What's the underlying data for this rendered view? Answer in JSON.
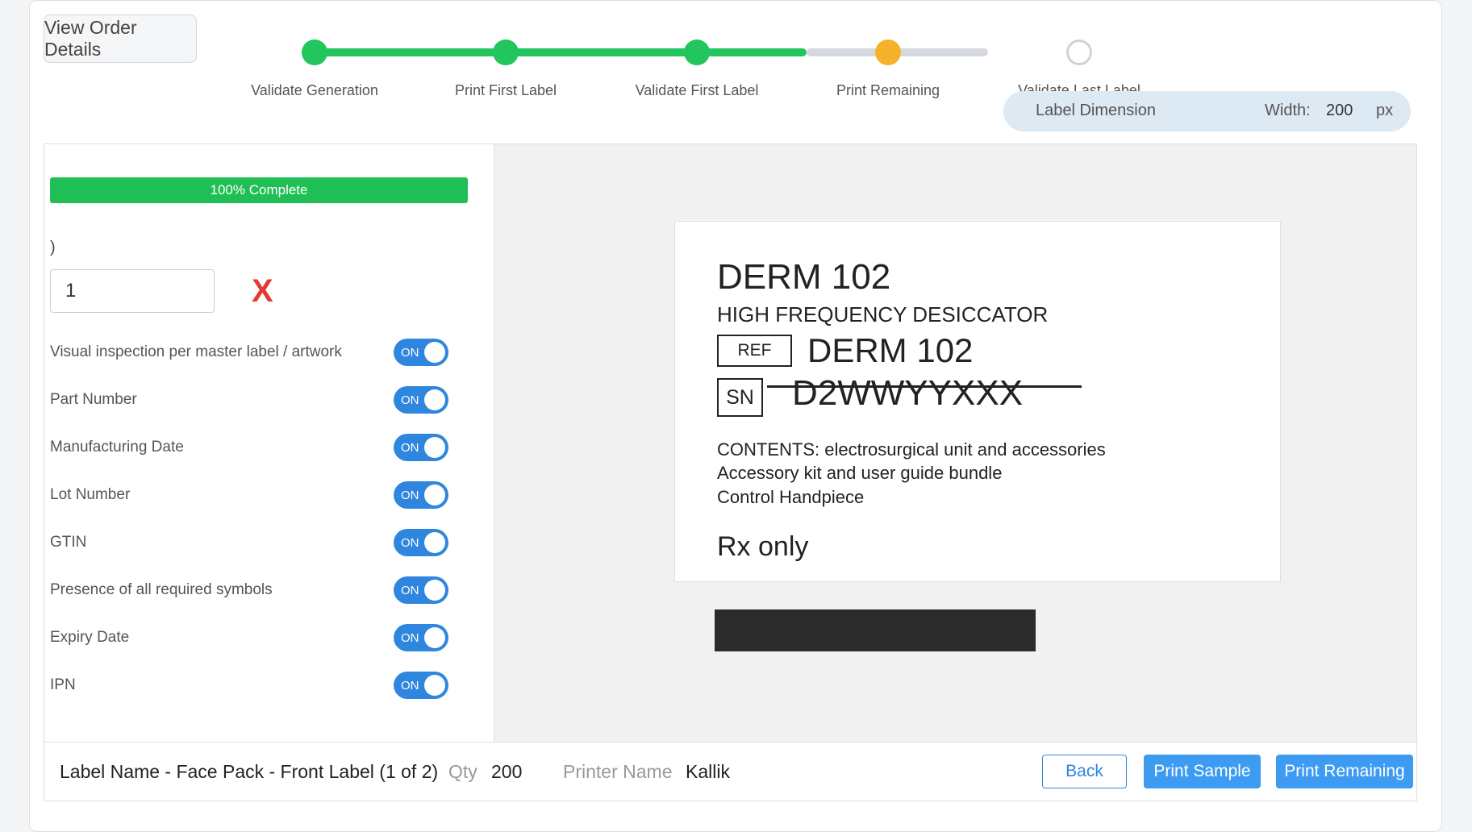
{
  "header": {
    "view_order_button": "View Order Details"
  },
  "stepper": {
    "steps": [
      {
        "label": "Validate Generation",
        "state": "done"
      },
      {
        "label": "Print First Label",
        "state": "done"
      },
      {
        "label": "Validate First Label",
        "state": "done"
      },
      {
        "label": "Print Remaining",
        "state": "current"
      },
      {
        "label": "Validate Last Label",
        "state": "pending"
      }
    ],
    "colors": {
      "done": "#22c55e",
      "current": "#f5b12a",
      "pending": "#d5d8dc"
    }
  },
  "label_dimension": {
    "title": "Label Dimension",
    "width_label": "Width:",
    "width_value": "200",
    "unit": "px"
  },
  "progress": {
    "text": "100% Complete",
    "percent": 100
  },
  "input": {
    "prefix": ")",
    "value": "1",
    "clear_glyph": "X"
  },
  "checks": [
    {
      "label": "Visual inspection per master label / artwork",
      "toggle": "ON"
    },
    {
      "label": "Part Number",
      "toggle": "ON"
    },
    {
      "label": "Manufacturing Date",
      "toggle": "ON"
    },
    {
      "label": "Lot Number",
      "toggle": "ON"
    },
    {
      "label": "GTIN",
      "toggle": "ON"
    },
    {
      "label": "Presence of all required symbols",
      "toggle": "ON"
    },
    {
      "label": "Expiry Date",
      "toggle": "ON"
    },
    {
      "label": "IPN",
      "toggle": "ON"
    }
  ],
  "label_preview": {
    "title": "DERM 102",
    "subtitle": "HIGH FREQUENCY DESICCATOR",
    "ref_tag": "REF",
    "ref_value": "DERM 102",
    "sn_tag": "SN",
    "sn_value": "D2WWYYXXX",
    "lines": [
      "CONTENTS: electrosurgical unit and accessories",
      "Accessory kit and user guide bundle",
      "Control Handpiece"
    ],
    "rx": "Rx only"
  },
  "footer": {
    "label_name": "Label Name - Face Pack - Front Label (1 of 2)",
    "qty_label": "Qty",
    "qty_value": "200",
    "printer_label": "Printer Name",
    "printer_value": "Kallik",
    "back_button": "Back",
    "print_sample_button": "Print Sample",
    "print_remaining_button": "Print Remaining"
  }
}
